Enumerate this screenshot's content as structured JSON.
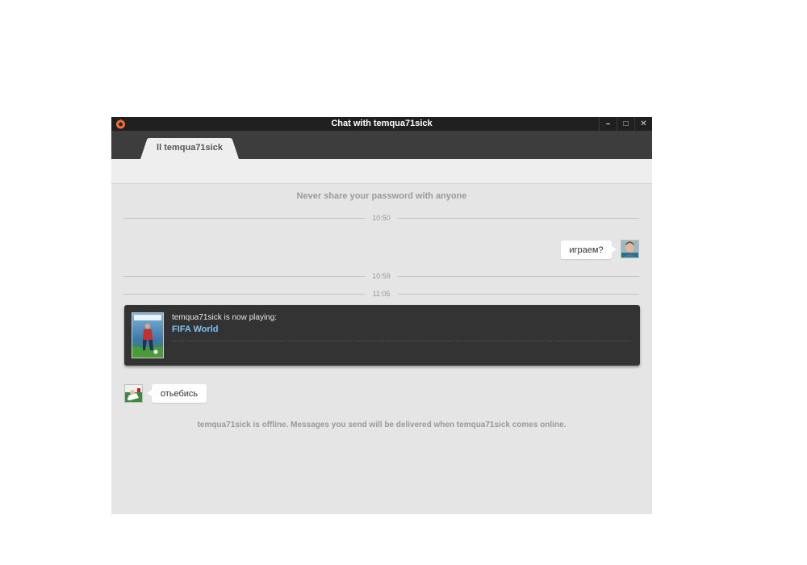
{
  "window": {
    "title": "Chat with temqua71sick",
    "controls": {
      "minimize": "–",
      "maximize": "□",
      "close": "✕"
    },
    "logo_icon": "origin-logo-icon"
  },
  "tabs": [
    {
      "label": "ll temqua71sick",
      "active": true
    }
  ],
  "chat": {
    "notice": "Never share your password with anyone",
    "timestamps": [
      "10:50",
      "10:59",
      "11:05"
    ],
    "messages": [
      {
        "from": "self",
        "text": "играем?"
      },
      {
        "from": "friend",
        "text": "отьебись"
      }
    ],
    "now_playing": {
      "text": "temqua71sick is now playing:",
      "game": "FIFA World"
    },
    "offline_notice": "temqua71sick is offline. Messages you send will be delivered when temqua71sick comes online."
  },
  "colors": {
    "titlebar": "#202020",
    "tabbar": "#3d3d3d",
    "chat_bg": "#e5e5e5",
    "logo_accent": "#f56c2d",
    "game_link": "#7cc4f4",
    "card_bg": "#333333"
  }
}
